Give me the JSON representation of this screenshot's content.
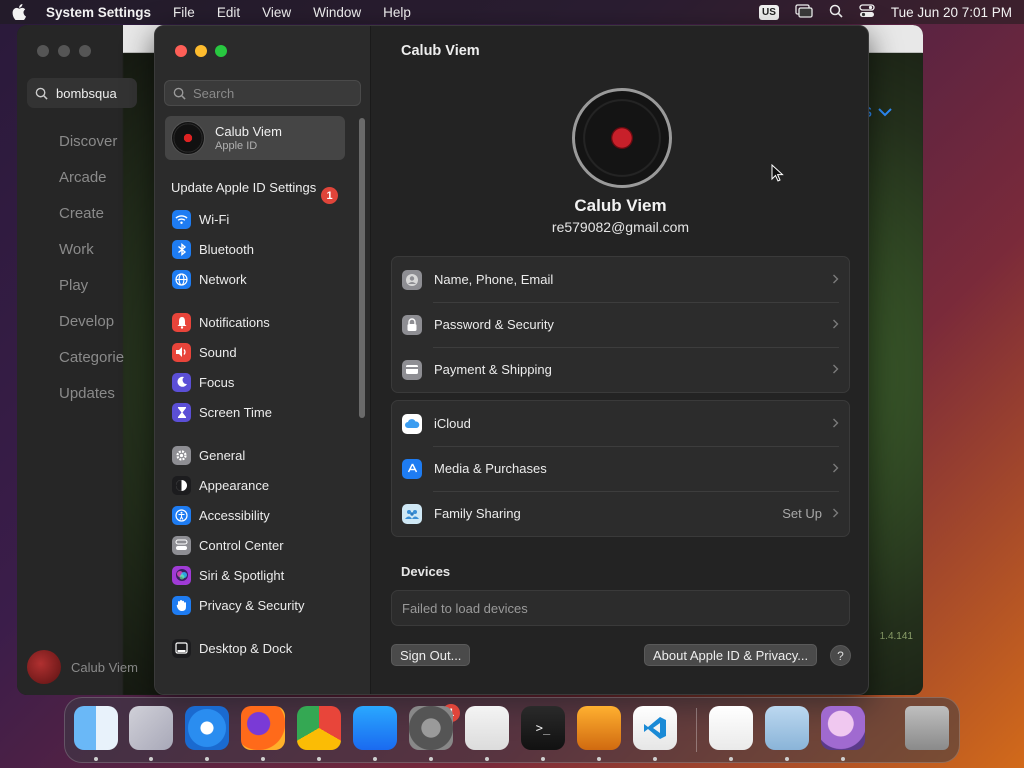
{
  "menubar": {
    "app_name": "System Settings",
    "items": [
      "File",
      "Edit",
      "View",
      "Window",
      "Help"
    ],
    "input_source": "US",
    "datetime": "Tue Jun 20  7:01 PM"
  },
  "background_window": {
    "search_value": "bombsqua",
    "nav": [
      "Discover",
      "Arcade",
      "Create",
      "Work",
      "Play",
      "Develop",
      "Categorie",
      "Updates"
    ],
    "user_name": "Calub Viem",
    "filters_label": "lters",
    "version": "1.4.141"
  },
  "sidebar": {
    "search_placeholder": "Search",
    "account": {
      "name": "Calub Viem",
      "sub": "Apple ID"
    },
    "update": {
      "label": "Update Apple ID Settings",
      "badge": "1"
    },
    "items": [
      {
        "label": "Wi-Fi",
        "icon": "wifi-icon",
        "color": "#1e7cf2"
      },
      {
        "label": "Bluetooth",
        "icon": "bluetooth-icon",
        "color": "#1e7cf2"
      },
      {
        "label": "Network",
        "icon": "globe-icon",
        "color": "#1e7cf2"
      },
      {
        "label": "Notifications",
        "icon": "bell-icon",
        "color": "#e8443a"
      },
      {
        "label": "Sound",
        "icon": "speaker-icon",
        "color": "#e8443a"
      },
      {
        "label": "Focus",
        "icon": "moon-icon",
        "color": "#5b4fd6"
      },
      {
        "label": "Screen Time",
        "icon": "hourglass-icon",
        "color": "#5b4fd6"
      },
      {
        "label": "General",
        "icon": "gear-icon",
        "color": "#8e8e93"
      },
      {
        "label": "Appearance",
        "icon": "appearance-icon",
        "color": "#1c1c1e"
      },
      {
        "label": "Accessibility",
        "icon": "accessibility-icon",
        "color": "#1e7cf2"
      },
      {
        "label": "Control Center",
        "icon": "control-center-icon",
        "color": "#8e8e93"
      },
      {
        "label": "Siri & Spotlight",
        "icon": "siri-icon",
        "color": "#a03bd6"
      },
      {
        "label": "Privacy & Security",
        "icon": "hand-icon",
        "color": "#1e7cf2"
      },
      {
        "label": "Desktop & Dock",
        "icon": "dock-icon",
        "color": "#1c1c1e"
      }
    ]
  },
  "main": {
    "title": "Calub Viem",
    "user_name": "Calub Viem",
    "email": "re579082@gmail.com",
    "group1": [
      {
        "label": "Name, Phone, Email",
        "icon": "person-icon",
        "color": "#8e8e93",
        "value": ""
      },
      {
        "label": "Password & Security",
        "icon": "lock-icon",
        "color": "#8e8e93",
        "value": ""
      },
      {
        "label": "Payment & Shipping",
        "icon": "card-icon",
        "color": "#8e8e93",
        "value": ""
      }
    ],
    "group2": [
      {
        "label": "iCloud",
        "icon": "cloud-icon",
        "color": "#ffffff",
        "value": ""
      },
      {
        "label": "Media & Purchases",
        "icon": "appstore-icon",
        "color": "#1e7cf2",
        "value": ""
      },
      {
        "label": "Family Sharing",
        "icon": "family-icon",
        "color": "#cfe8f5",
        "value": "Set Up"
      }
    ],
    "devices_heading": "Devices",
    "devices_status": "Failed to load devices",
    "sign_out": "Sign Out...",
    "about": "About Apple ID & Privacy...",
    "help": "?"
  },
  "dock": {
    "apps": [
      "Finder",
      "Launchpad",
      "Safari",
      "Firefox",
      "Chrome",
      "App Store",
      "System Settings",
      "TextEdit",
      "Terminal",
      "GarageBand",
      "Visual Studio Code",
      "Freeform",
      "Preview",
      "Bomb Squad",
      "Trash"
    ],
    "settings_badge": "1"
  }
}
